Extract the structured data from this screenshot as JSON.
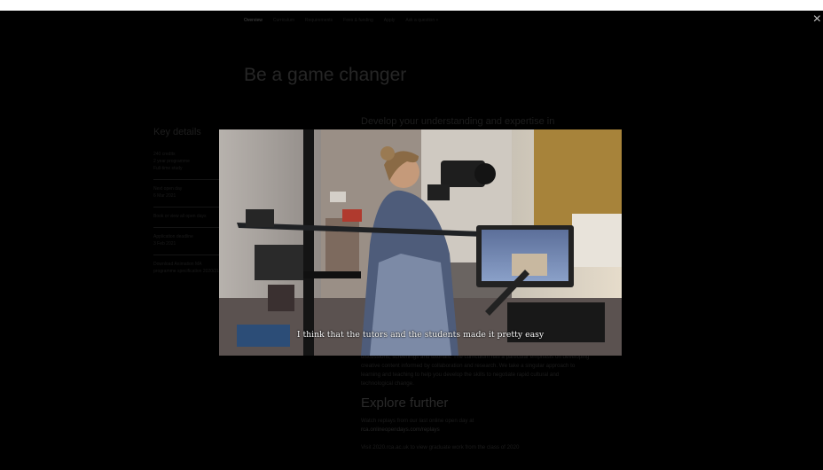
{
  "nav": {
    "items": [
      "Overview",
      "Curriculum",
      "Requirements",
      "Fees & funding",
      "Apply",
      "Ask a question +"
    ]
  },
  "close_icon_glyph": "×",
  "page": {
    "headline": "Be a game changer",
    "intro": "Develop your understanding and expertise in"
  },
  "sidebar": {
    "title": "Key details",
    "facts": [
      "240 credits",
      "2 year programme",
      "Full-time study"
    ],
    "open_day_label": "Next open day",
    "open_day_date": "6 Mar 2021",
    "open_day_link": "Book or view all open days",
    "deadline_label": "Application deadline",
    "deadline_date": "3 Feb 2021",
    "download_link": "Download Animation MA programme specification 2020/21"
  },
  "article": {
    "paragraph": "discussions, screenings and tutorials. The curriculum has a particular emphasis on developing creative content informed by collaboration and research. We take a singular approach to learning and teaching to help you develop the skills to negotiate rapid cultural and technological change.",
    "heading": "Explore further",
    "link1_prefix": "Watch replays from our last online open day at",
    "link1_url": "rca.onlineopendays.com/replays",
    "link2_text": "Visit 2020.rca.ac.uk to view graduate work from the class of 2020"
  },
  "video": {
    "subtitle": "I think that the tutors and the students made it pretty easy"
  }
}
